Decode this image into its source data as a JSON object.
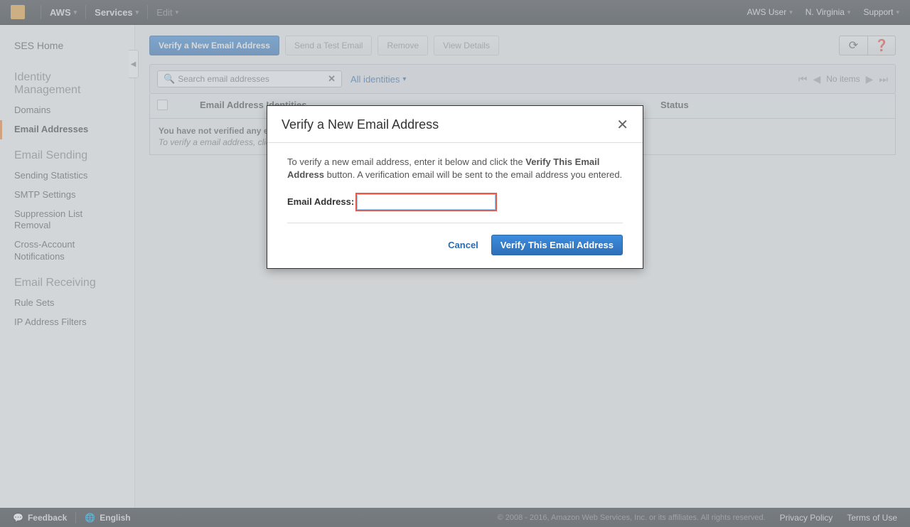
{
  "topnav": {
    "aws": "AWS",
    "services": "Services",
    "edit": "Edit",
    "user": "AWS User",
    "region": "N. Virginia",
    "support": "Support"
  },
  "sidebar": {
    "home": "SES Home",
    "identity_title": "Identity Management",
    "identity_items": [
      "Domains",
      "Email Addresses"
    ],
    "sending_title": "Email Sending",
    "sending_items": [
      "Sending Statistics",
      "SMTP Settings",
      "Suppression List Removal",
      "Cross-Account Notifications"
    ],
    "receiving_title": "Email Receiving",
    "receiving_items": [
      "Rule Sets",
      "IP Address Filters"
    ]
  },
  "toolbar": {
    "verify": "Verify a New Email Address",
    "send_test": "Send a Test Email",
    "remove": "Remove",
    "view_details": "View Details"
  },
  "filter": {
    "search_placeholder": "Search email addresses",
    "all_identities": "All identities",
    "no_items": "No items"
  },
  "table": {
    "col_name": "Email Address Identities",
    "col_status": "Status",
    "empty1": "You have not verified any email addresses.",
    "empty2": "To verify a email address, click the Verify a New Email Address button."
  },
  "modal": {
    "title": "Verify a New Email Address",
    "body_pre": "To verify a new email address, enter it below and click the ",
    "body_bold": "Verify This Email Address",
    "body_post": " button. A verification email will be sent to the email address you entered.",
    "field_label": "Email Address:",
    "field_value": "",
    "cancel": "Cancel",
    "confirm": "Verify This Email Address"
  },
  "footer": {
    "feedback": "Feedback",
    "language": "English",
    "copyright": "© 2008 - 2016, Amazon Web Services, Inc. or its affiliates. All rights reserved.",
    "privacy": "Privacy Policy",
    "terms": "Terms of Use"
  }
}
